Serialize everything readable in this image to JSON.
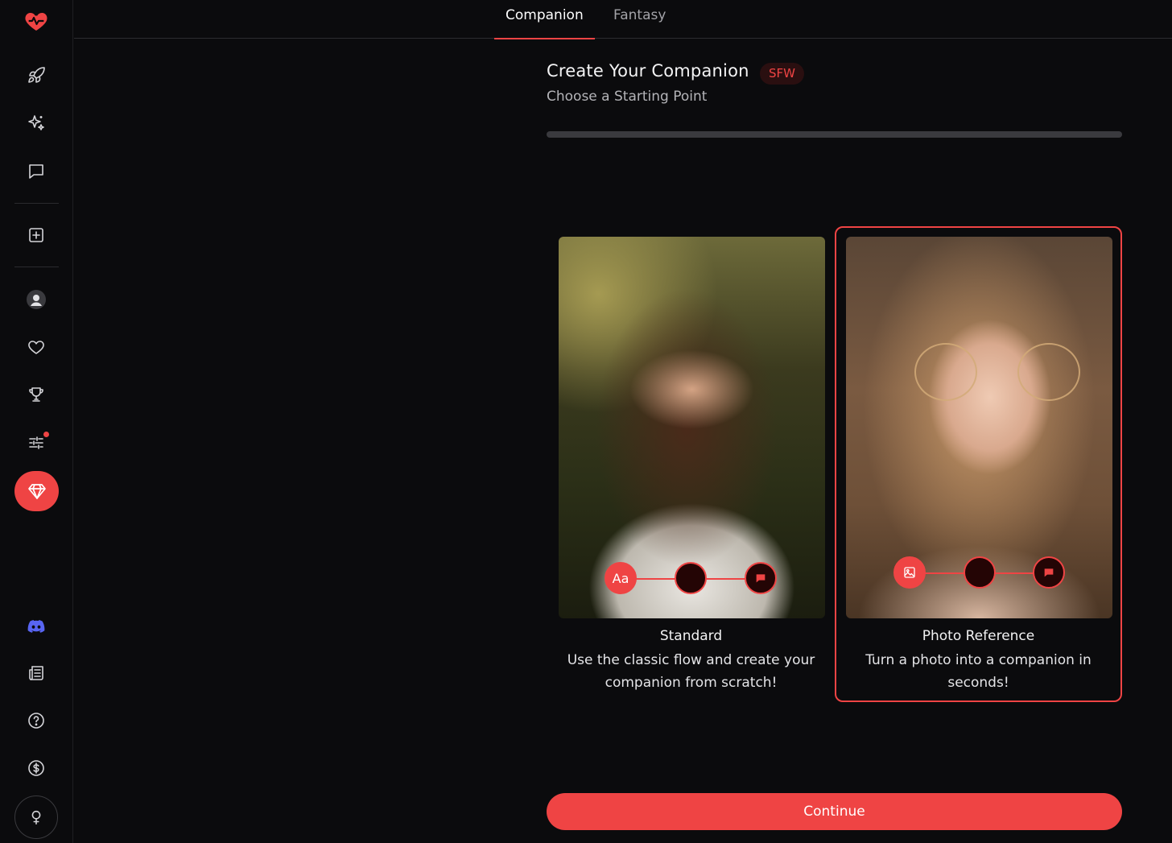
{
  "sidebar": {
    "items": [
      {
        "icon": "heart-pulse-icon",
        "active": false
      },
      {
        "icon": "rocket-icon",
        "active": false
      },
      {
        "icon": "sparkles-icon",
        "active": false
      },
      {
        "icon": "chat-icon",
        "active": false
      },
      {
        "icon": "plus-square-icon",
        "active": false
      },
      {
        "icon": "user-avatar-icon",
        "active": false
      },
      {
        "icon": "heart-icon",
        "active": false
      },
      {
        "icon": "trophy-icon",
        "active": false
      },
      {
        "icon": "sliders-icon",
        "active": false,
        "notification_dot": true
      },
      {
        "icon": "diamond-icon",
        "active": true
      },
      {
        "icon": "discord-icon",
        "active": false
      },
      {
        "icon": "newspaper-icon",
        "active": false
      },
      {
        "icon": "help-icon",
        "active": false
      },
      {
        "icon": "dollar-icon",
        "active": false
      },
      {
        "icon": "female-icon",
        "active": false
      }
    ]
  },
  "tabs": [
    {
      "label": "Companion",
      "active": true
    },
    {
      "label": "Fantasy",
      "active": false
    }
  ],
  "header": {
    "title": "Create Your Companion",
    "badge": "SFW",
    "subtitle": "Choose a Starting Point"
  },
  "progress": {
    "fraction": 0.0
  },
  "cards": [
    {
      "title": "Standard",
      "description": "Use the classic flow and create your companion from scratch!",
      "selected": false,
      "step_icons": [
        "Aa",
        "",
        "chat-bubble-icon"
      ]
    },
    {
      "title": "Photo Reference",
      "description": "Turn a photo into a companion in seconds!",
      "selected": true,
      "step_icons": [
        "image-icon",
        "",
        "chat-bubble-icon"
      ]
    }
  ],
  "continue_label": "Continue",
  "colors": {
    "accent": "#ef4444",
    "background": "#0b0b0d",
    "discord": "#5865f2",
    "badge_bg": "#2a0f10"
  }
}
